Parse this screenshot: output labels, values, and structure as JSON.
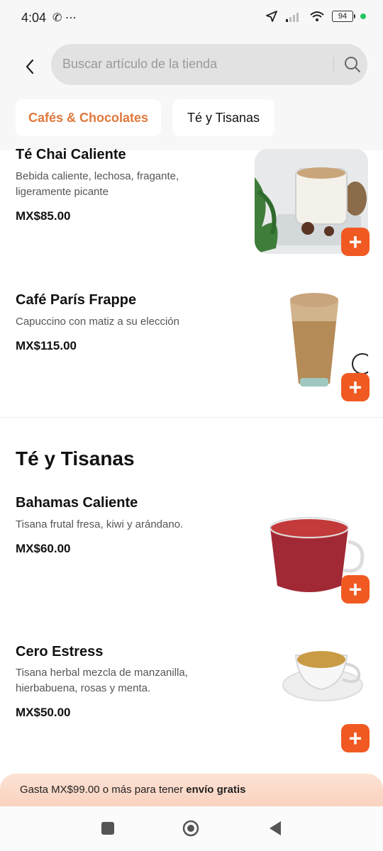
{
  "status_bar": {
    "time": "4:04",
    "left_icons": "✆ ⋯",
    "battery": "94"
  },
  "search": {
    "placeholder": "Buscar artículo de la tienda"
  },
  "tabs": [
    {
      "label": "Cafés & Chocolates",
      "active": true
    },
    {
      "label": "Té y Tisanas",
      "active": false
    }
  ],
  "products": [
    {
      "name": "Té Chai Caliente",
      "description": "Bebida caliente, lechosa, fragante, ligeramente picante",
      "price": "MX$85.00"
    },
    {
      "name": "Café París Frappe",
      "description": "Capuccino con matiz a su elección",
      "price": "MX$115.00"
    },
    {
      "name": "Bahamas Caliente",
      "description": "Tisana frutal fresa, kiwi y arándano.",
      "price": "MX$60.00"
    },
    {
      "name": "Cero Estress",
      "description": "Tisana herbal mezcla de manzanilla, hierbabuena, rosas y menta.",
      "price": "MX$50.00"
    }
  ],
  "section": {
    "title": "Té y Tisanas"
  },
  "add_label": "+",
  "banner": {
    "prefix": "Gasta MX$99.00 o más para tener ",
    "bold": "envío gratis"
  },
  "colors": {
    "accent": "#f05a22",
    "tab_active": "#e0783b"
  },
  "icons": {
    "back": "chevron-left-icon",
    "search": "search-icon",
    "add": "plus-icon",
    "nav_recents": "square-icon",
    "nav_home": "circle-icon",
    "nav_back": "triangle-left-icon"
  }
}
